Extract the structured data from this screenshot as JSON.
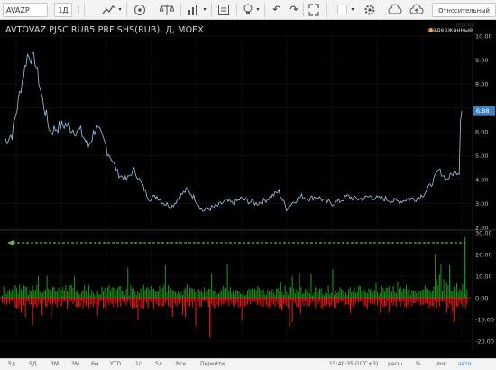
{
  "toolbar": {
    "symbol": "AVAZP",
    "interval": "1Д",
    "scale_mode": "Относительный дейлы",
    "icons": [
      "chevron-down-icon",
      "more-icon",
      "line-chart-icon",
      "indicator-fx-icon",
      "scales-icon",
      "compare-chart-icon",
      "alert-icon",
      "idea-bulb-icon",
      "undo-icon",
      "redo-icon",
      "fullscreen-icon",
      "checkbox-icon",
      "settings-gear-icon",
      "cloud-icon",
      "cloud-upload-icon",
      "camera-icon"
    ]
  },
  "header": {
    "title": "AVTOVAZ PJSC RUB5 PRF SHS(RUB), Д, MOEX",
    "delayed_label": "задержанные"
  },
  "colors": {
    "background": "#000000",
    "price_line": "#9fc3e8",
    "volume_up": "#1e8a1e",
    "volume_down": "#d81a1a",
    "arrow": "#55b545",
    "price_badge": "#3e80c8",
    "delayed_dot": "#ff7a2a"
  },
  "chart_data": [
    {
      "type": "line",
      "name": "price",
      "x_tick_labels": [
        "2012",
        "Июл",
        "2013",
        "Июл",
        "2014",
        "Июл",
        "2015",
        "Июл",
        "2016",
        "Июл",
        "2017"
      ],
      "y_tick_labels": [
        "10.00",
        "9.00",
        "8.00",
        "7.00",
        "6.00",
        "5.00",
        "4.00",
        "3.00",
        "2.00"
      ],
      "ylim": [
        2,
        10
      ],
      "last_value": "6.88",
      "x": [
        "2012-01",
        "2012-02",
        "2012-03",
        "2012-04",
        "2012-05",
        "2012-06",
        "2012-07",
        "2012-08",
        "2012-09",
        "2012-10",
        "2012-11",
        "2012-12",
        "2013-01",
        "2013-02",
        "2013-03",
        "2013-04",
        "2013-05",
        "2013-06",
        "2013-07",
        "2013-08",
        "2013-09",
        "2013-10",
        "2013-11",
        "2013-12",
        "2014-01",
        "2014-02",
        "2014-03",
        "2014-04",
        "2014-05",
        "2014-06",
        "2014-07",
        "2014-08",
        "2014-09",
        "2014-10",
        "2014-11",
        "2014-12",
        "2015-01",
        "2015-02",
        "2015-03",
        "2015-04",
        "2015-05",
        "2015-06",
        "2015-07",
        "2015-08",
        "2015-09",
        "2015-10",
        "2015-11",
        "2015-12",
        "2016-01",
        "2016-02",
        "2016-03",
        "2016-04",
        "2016-05",
        "2016-06",
        "2016-07",
        "2016-08",
        "2016-09",
        "2016-10",
        "2016-11",
        "2016-12",
        "2017-01"
      ],
      "values": [
        5.6,
        5.9,
        7.6,
        9.2,
        9.0,
        7.3,
        6.0,
        6.2,
        6.3,
        6.1,
        6.0,
        5.4,
        6.2,
        5.6,
        4.9,
        4.2,
        4.0,
        4.4,
        3.8,
        3.2,
        3.3,
        3.0,
        2.9,
        3.3,
        3.6,
        3.2,
        2.7,
        2.8,
        2.9,
        3.1,
        3.0,
        3.2,
        3.1,
        3.0,
        3.1,
        3.3,
        3.5,
        2.8,
        3.1,
        3.3,
        3.2,
        3.3,
        3.1,
        3.0,
        3.1,
        3.3,
        3.2,
        3.2,
        3.3,
        3.2,
        3.2,
        3.1,
        3.1,
        3.2,
        3.2,
        3.4,
        3.8,
        4.4,
        4.0,
        4.3,
        6.88
      ]
    },
    {
      "type": "bar",
      "name": "volume",
      "y_tick_labels": [
        "30.00",
        "20.00",
        "10.00",
        "0.00",
        "-10.00",
        "-20.00"
      ],
      "ylim": [
        -20,
        30
      ]
    }
  ],
  "bottom_bar": {
    "ranges": [
      "5д",
      "5Д",
      "3М",
      "3М",
      "6м",
      "YTD",
      "1г",
      "5л",
      "Все"
    ],
    "goto": "Перейти...",
    "time": "15:40:35 (UTC+3)",
    "session": "расш",
    "percent": "%",
    "log": "лог",
    "auto": "авто"
  }
}
